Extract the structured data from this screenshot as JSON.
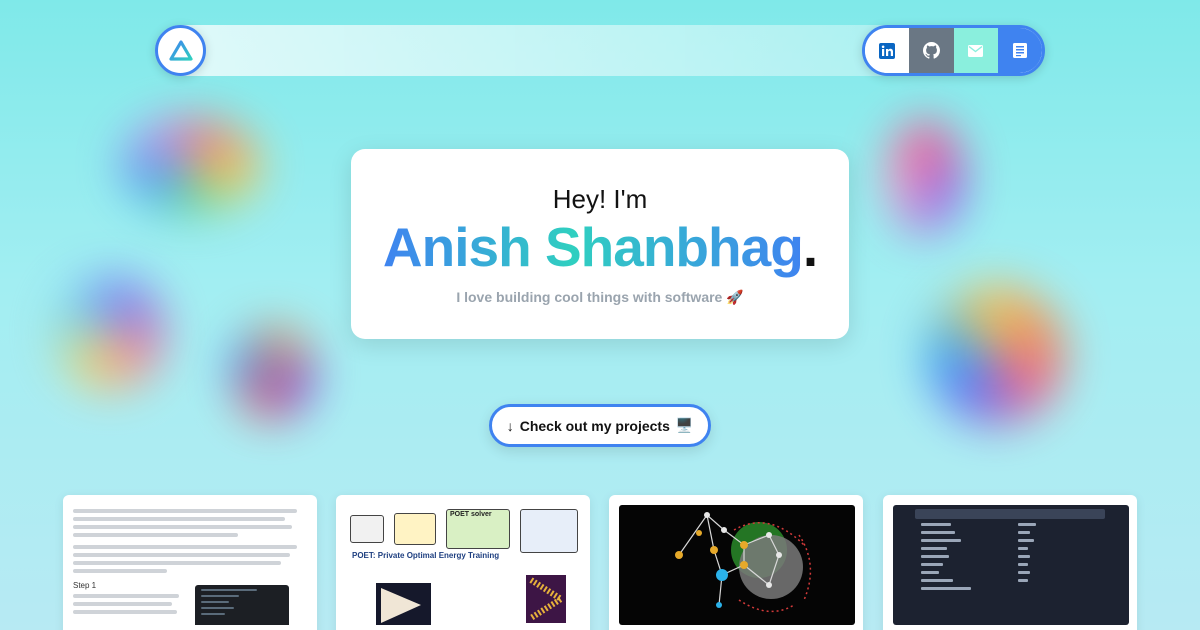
{
  "header": {
    "logo": "triangle-logo-icon",
    "social": [
      {
        "name": "LinkedIn",
        "icon": "linkedin-icon",
        "color": "#0a66c2"
      },
      {
        "name": "GitHub",
        "icon": "github-icon",
        "color": "#6a7784"
      },
      {
        "name": "Email",
        "icon": "mail-icon",
        "color": "#8aefdd"
      },
      {
        "name": "Blog",
        "icon": "document-icon",
        "color": "#3f83f0"
      }
    ]
  },
  "hero": {
    "greeting": "Hey! I'm",
    "name": "Anish Shanbhag",
    "name_suffix": ".",
    "tagline": "I love building cool things with software 🚀"
  },
  "cta": {
    "label": "Check out my projects",
    "arrow": "↓",
    "emoji": "🖥️"
  },
  "projects": {
    "blog_step": "Step 1",
    "paper_title": "POET: Private Optimal Energy Training",
    "paper_solver": "POET solver"
  },
  "colors": {
    "accent": "#3f83f0",
    "accent2": "#30cfc0",
    "text": "#121212",
    "muted": "#9aa4ae"
  }
}
